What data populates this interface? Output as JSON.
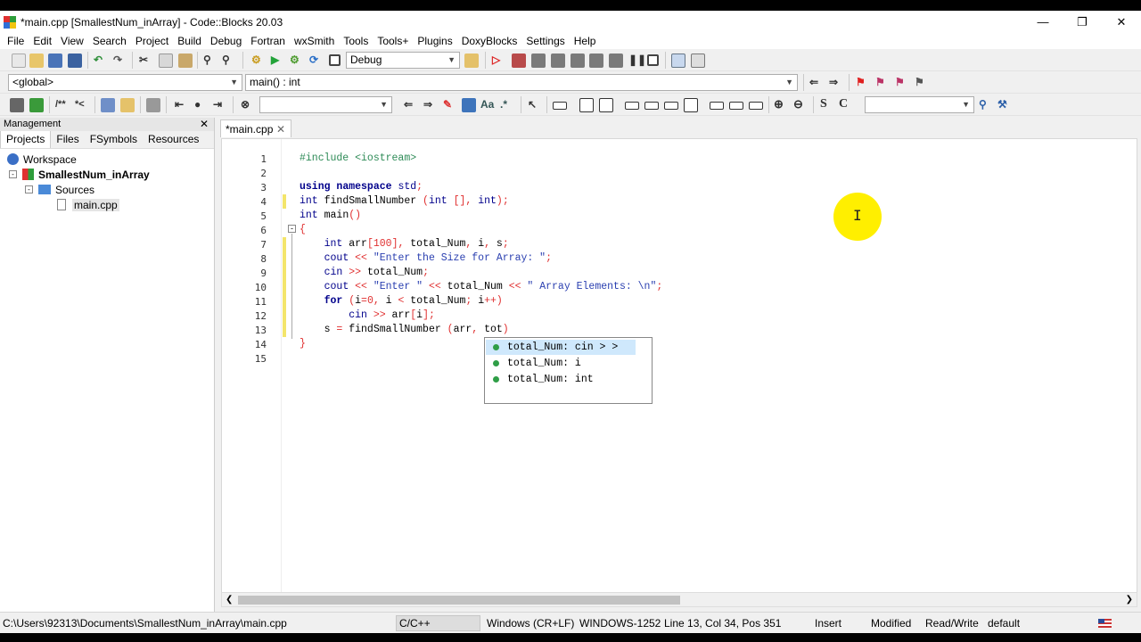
{
  "window": {
    "title": "*main.cpp [SmallestNum_inArray] - Code::Blocks 20.03"
  },
  "menu": [
    "File",
    "Edit",
    "View",
    "Search",
    "Project",
    "Build",
    "Debug",
    "Fortran",
    "wxSmith",
    "Tools",
    "Tools+",
    "Plugins",
    "DoxyBlocks",
    "Settings",
    "Help"
  ],
  "toolbar": {
    "build_target": "Debug",
    "scope": "<global>",
    "function": "main() : int",
    "search_placeholder": "",
    "search2_placeholder": ""
  },
  "management": {
    "title": "Management",
    "tabs": [
      "Projects",
      "Files",
      "FSymbols",
      "Resources"
    ],
    "tree": {
      "workspace": "Workspace",
      "project": "SmallestNum_inArray",
      "folder": "Sources",
      "file": "main.cpp"
    }
  },
  "editor": {
    "tab": "*main.cpp",
    "line_numbers": [
      "1",
      "2",
      "3",
      "4",
      "5",
      "6",
      "7",
      "8",
      "9",
      "10",
      "11",
      "12",
      "13",
      "14",
      "15"
    ],
    "lines": [
      [
        [
          "pp",
          "#include <iostream>"
        ]
      ],
      [],
      [
        [
          "kw",
          "using"
        ],
        [
          "id",
          " "
        ],
        [
          "kw",
          "namespace"
        ],
        [
          "id",
          " "
        ],
        [
          "ty",
          "std"
        ],
        [
          "op",
          ";"
        ]
      ],
      [
        [
          "ty",
          "int"
        ],
        [
          "id",
          " findSmallNumber "
        ],
        [
          "op",
          "("
        ],
        [
          "ty",
          "int"
        ],
        [
          "id",
          " "
        ],
        [
          "op",
          "[],"
        ],
        [
          "id",
          " "
        ],
        [
          "ty",
          "int"
        ],
        [
          "op",
          ");"
        ]
      ],
      [
        [
          "ty",
          "int"
        ],
        [
          "id",
          " main"
        ],
        [
          "op",
          "()"
        ]
      ],
      [
        [
          "op",
          "{"
        ]
      ],
      [
        [
          "id",
          "    "
        ],
        [
          "ty",
          "int"
        ],
        [
          "id",
          " arr"
        ],
        [
          "op",
          "["
        ],
        [
          "nm",
          "100"
        ],
        [
          "op",
          "],"
        ],
        [
          "id",
          " total_Num"
        ],
        [
          "op",
          ","
        ],
        [
          "id",
          " i"
        ],
        [
          "op",
          ","
        ],
        [
          "id",
          " s"
        ],
        [
          "op",
          ";"
        ]
      ],
      [
        [
          "id",
          "    "
        ],
        [
          "ty",
          "cout"
        ],
        [
          "id",
          " "
        ],
        [
          "op",
          "<<"
        ],
        [
          "id",
          " "
        ],
        [
          "st",
          "\"Enter the Size for Array: \""
        ],
        [
          "op",
          ";"
        ]
      ],
      [
        [
          "id",
          "    "
        ],
        [
          "ty",
          "cin"
        ],
        [
          "id",
          " "
        ],
        [
          "op",
          ">>"
        ],
        [
          "id",
          " total_Num"
        ],
        [
          "op",
          ";"
        ]
      ],
      [
        [
          "id",
          "    "
        ],
        [
          "ty",
          "cout"
        ],
        [
          "id",
          " "
        ],
        [
          "op",
          "<<"
        ],
        [
          "id",
          " "
        ],
        [
          "st",
          "\"Enter \""
        ],
        [
          "id",
          " "
        ],
        [
          "op",
          "<<"
        ],
        [
          "id",
          " total_Num "
        ],
        [
          "op",
          "<<"
        ],
        [
          "id",
          " "
        ],
        [
          "st",
          "\" Array Elements: \\n\""
        ],
        [
          "op",
          ";"
        ]
      ],
      [
        [
          "id",
          "    "
        ],
        [
          "kw",
          "for"
        ],
        [
          "id",
          " "
        ],
        [
          "op",
          "("
        ],
        [
          "id",
          "i"
        ],
        [
          "op",
          "="
        ],
        [
          "nm",
          "0"
        ],
        [
          "op",
          ","
        ],
        [
          "id",
          " i "
        ],
        [
          "op",
          "<"
        ],
        [
          "id",
          " total_Num"
        ],
        [
          "op",
          ";"
        ],
        [
          "id",
          " i"
        ],
        [
          "op",
          "++)"
        ]
      ],
      [
        [
          "id",
          "        "
        ],
        [
          "ty",
          "cin"
        ],
        [
          "id",
          " "
        ],
        [
          "op",
          ">>"
        ],
        [
          "id",
          " arr"
        ],
        [
          "op",
          "["
        ],
        [
          "id",
          "i"
        ],
        [
          "op",
          "];"
        ]
      ],
      [
        [
          "id",
          "    s "
        ],
        [
          "op",
          "="
        ],
        [
          "id",
          " findSmallNumber "
        ],
        [
          "op",
          "("
        ],
        [
          "id",
          "arr"
        ],
        [
          "op",
          ","
        ],
        [
          "id",
          " tot"
        ],
        [
          "op",
          ")"
        ]
      ],
      [
        [
          "op",
          "}"
        ]
      ],
      []
    ],
    "autocomplete": [
      "total_Num: cin > >",
      "total_Num: i",
      "total_Num: int"
    ]
  },
  "statusbar": {
    "path": "C:\\Users\\92313\\Documents\\SmallestNum_inArray\\main.cpp",
    "language": "C/C++",
    "eol": "Windows (CR+LF)",
    "encoding": "WINDOWS-1252",
    "position": "Line 13, Col 34, Pos 351",
    "mode": "Insert",
    "modified": "Modified",
    "access": "Read/Write",
    "profile": "default"
  }
}
